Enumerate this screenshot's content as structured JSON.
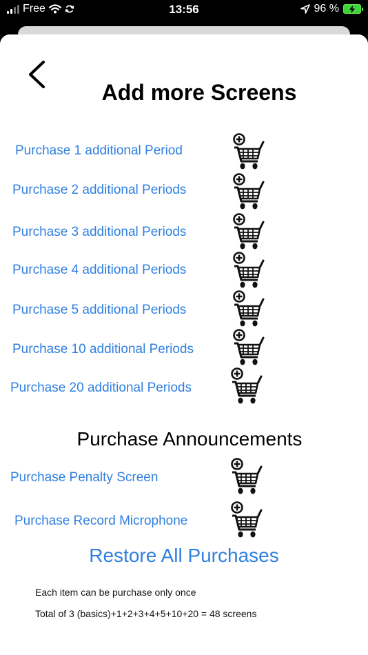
{
  "status_bar": {
    "carrier": "Free",
    "time": "13:56",
    "battery_percent": "96 %",
    "battery_level": 0.96,
    "icons": [
      "signal-icon",
      "wifi-icon",
      "sync-icon",
      "location-icon",
      "battery-charging-icon"
    ]
  },
  "header": {
    "back_icon": "chevron-left-icon",
    "title": "Add more Screens"
  },
  "screen_purchases": [
    {
      "label": "Purchase 1 additional Period",
      "icon": "add-to-cart-icon"
    },
    {
      "label": "Purchase 2 additional Periods",
      "icon": "add-to-cart-icon"
    },
    {
      "label": "Purchase 3 additional Periods",
      "icon": "add-to-cart-icon"
    },
    {
      "label": "Purchase 4 additional Periods",
      "icon": "add-to-cart-icon"
    },
    {
      "label": "Purchase 5 additional Periods",
      "icon": "add-to-cart-icon"
    },
    {
      "label": "Purchase 10 additional Periods",
      "icon": "add-to-cart-icon"
    },
    {
      "label": "Purchase 20 additional Periods",
      "icon": "add-to-cart-icon"
    }
  ],
  "announcements": {
    "title": "Purchase Announcements",
    "items": [
      {
        "label": "Purchase Penalty Screen",
        "icon": "add-to-cart-icon"
      },
      {
        "label": "Purchase Record Microphone",
        "icon": "add-to-cart-icon"
      }
    ]
  },
  "restore_label": "Restore All Purchases",
  "notes": {
    "once": "Each item can be purchase only once",
    "total": "Total of 3 (basics)+1+2+3+4+5+10+20 = 48 screens"
  },
  "colors": {
    "link": "#2f7fe0",
    "background": "#ffffff",
    "status_bar": "#000000",
    "battery": "#3ed33e"
  }
}
